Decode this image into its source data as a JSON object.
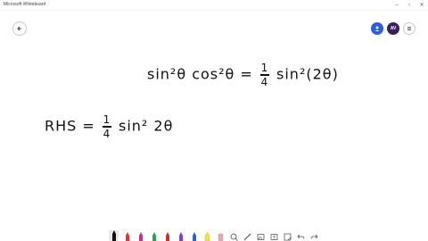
{
  "window": {
    "title": "Microsoft Whiteboard"
  },
  "header": {
    "avatar_initials": "AV"
  },
  "canvas": {
    "equation1": {
      "left": "sin²θ cos²θ =",
      "numerator": "1",
      "denominator": "4",
      "right": "sin²(2θ)"
    },
    "equation2": {
      "left": "RHS =",
      "numerator": "1",
      "denominator": "4",
      "right": "sin² 2θ"
    }
  },
  "toolbar": {
    "tools": [
      "pen-black",
      "pen-red",
      "pen-magenta",
      "pen-green",
      "pen-red-2",
      "pen-purple",
      "pen-blue",
      "highlighter-yellow",
      "eraser",
      "lasso",
      "ruler",
      "image",
      "text",
      "note",
      "undo",
      "redo"
    ]
  },
  "colors": {
    "pen_black": "#111111",
    "pen_red": "#e0343a",
    "pen_magenta": "#d12a8f",
    "pen_green": "#2aa048",
    "pen_purple": "#8a3cc8",
    "pen_blue": "#2b5fd9",
    "highlighter_yellow": "#f5e040",
    "share": "#2b5fd9",
    "avatar": "#3d1e5c"
  }
}
